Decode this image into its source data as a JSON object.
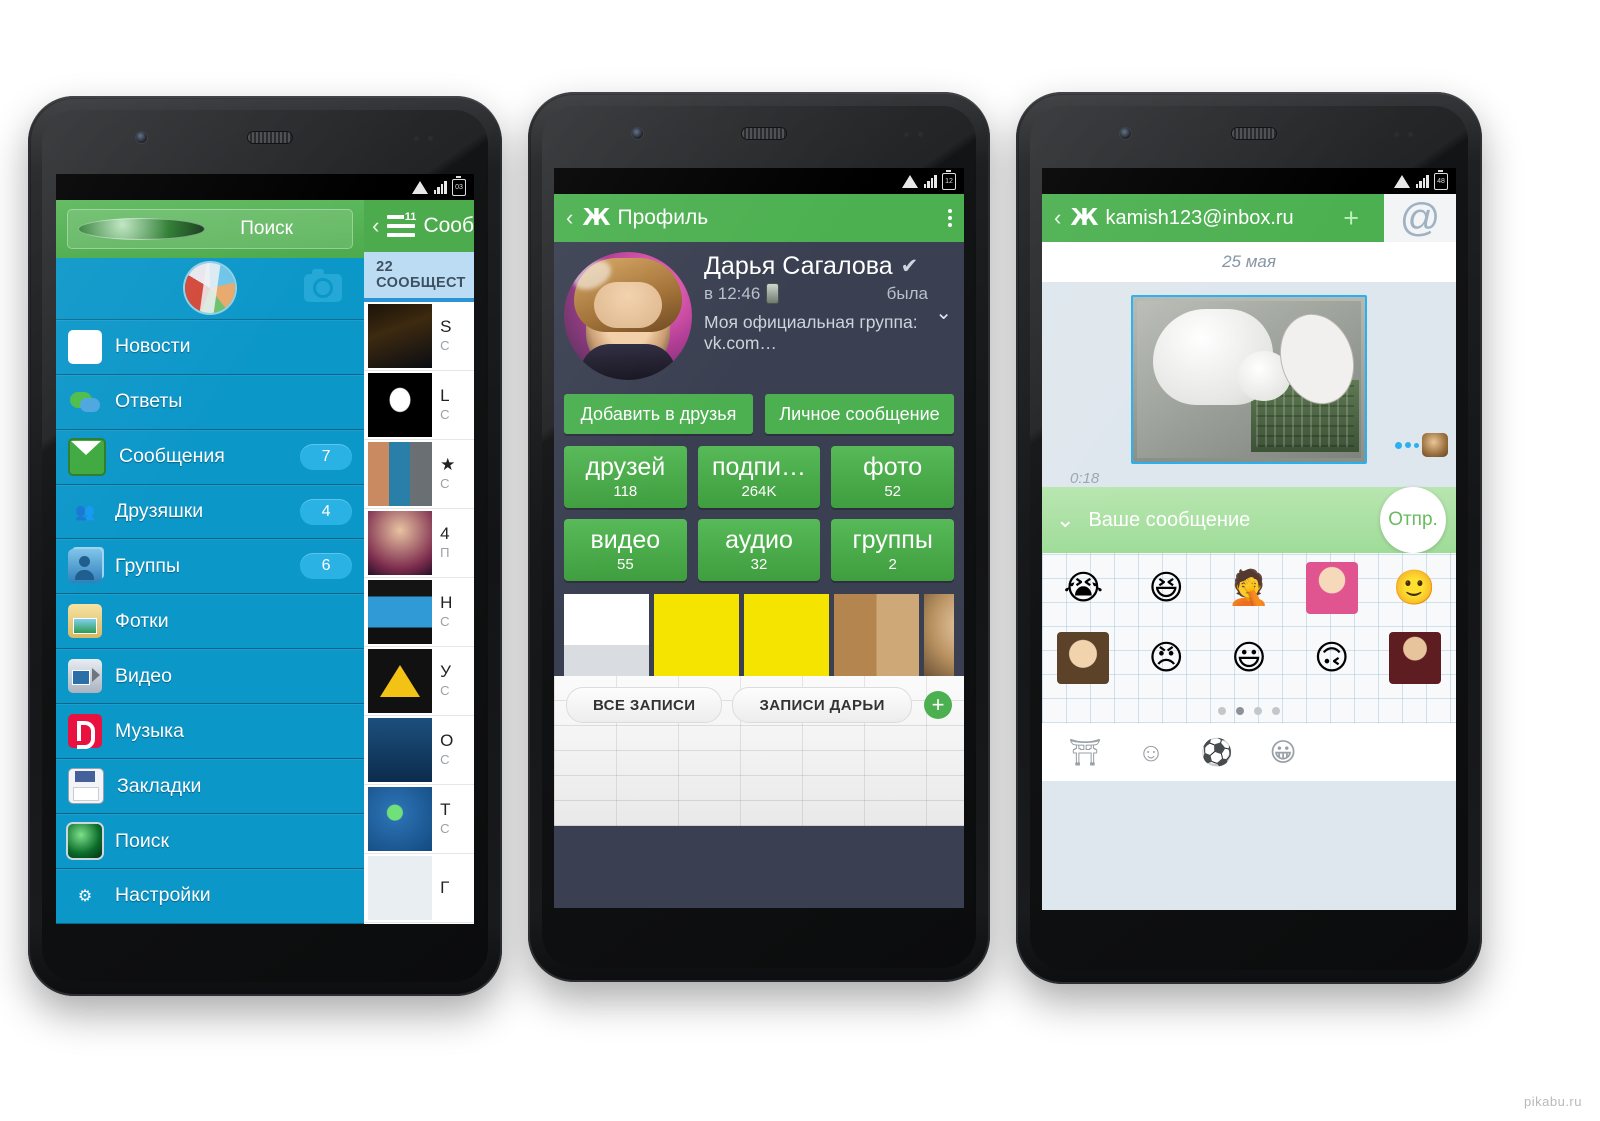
{
  "watermark": "pikabu.ru",
  "phone1": {
    "statusbar": {
      "battery": "03"
    },
    "search": {
      "placeholder": "Поиск",
      "icon": "globe-icon"
    },
    "avatar_row": {
      "avatar": "user-avatar",
      "camera": "camera-icon"
    },
    "menu": [
      {
        "label": "Новости",
        "icon": "cnn-news-icon",
        "badge": ""
      },
      {
        "label": "Ответы",
        "icon": "comments-icon",
        "badge": ""
      },
      {
        "label": "Сообщения",
        "icon": "envelope-icon",
        "badge": "7"
      },
      {
        "label": "Друзяшки",
        "icon": "friends-icon",
        "badge": "4"
      },
      {
        "label": "Группы",
        "icon": "groups-icon",
        "badge": "6"
      },
      {
        "label": "Фотки",
        "icon": "photo-folder-icon",
        "badge": ""
      },
      {
        "label": "Видео",
        "icon": "camcorder-icon",
        "badge": ""
      },
      {
        "label": "Музыка",
        "icon": "beats-music-icon",
        "badge": ""
      },
      {
        "label": "Закладки",
        "icon": "floppy-disk-icon",
        "badge": ""
      },
      {
        "label": "Поиск",
        "icon": "radar-icon",
        "badge": ""
      },
      {
        "label": "Настройки",
        "icon": "gear-icon",
        "badge": ""
      }
    ],
    "peek": {
      "back": "‹",
      "menu_badge": "11",
      "title": "Сооб",
      "subheader": "22 СООБЩЕСТ",
      "rows": [
        {
          "title": "S",
          "sub": "С"
        },
        {
          "title": "L",
          "sub": "С"
        },
        {
          "title": "★",
          "sub": "С"
        },
        {
          "title": "4",
          "sub": "П"
        },
        {
          "title": "Н",
          "sub": "С"
        },
        {
          "title": "У",
          "sub": "С"
        },
        {
          "title": "О",
          "sub": "С"
        },
        {
          "title": "Т",
          "sub": "С"
        },
        {
          "title": "Г",
          "sub": ""
        }
      ]
    }
  },
  "phone2": {
    "statusbar": {
      "battery": "12"
    },
    "appbar": {
      "back": "‹",
      "logo": "vk-logo",
      "title": "Профиль",
      "overflow": "kebab-menu-icon"
    },
    "profile": {
      "name": "Дарья Сагалова",
      "verified": "✔",
      "last_seen_left": "в 12:46",
      "last_seen_right": "была",
      "description": "Моя официальная группа: vk.com…",
      "expand": "⌄"
    },
    "actions": [
      {
        "label": "Добавить в друзья"
      },
      {
        "label": "Личное сообщение"
      }
    ],
    "stats": [
      {
        "key": "друзей",
        "value": "118"
      },
      {
        "key": "подпи…",
        "value": "264K"
      },
      {
        "key": "фото",
        "value": "52"
      },
      {
        "key": "видео",
        "value": "55"
      },
      {
        "key": "аудио",
        "value": "32"
      },
      {
        "key": "группы",
        "value": "2"
      }
    ],
    "photos": [
      {
        "alt": "russian-charity-poster"
      },
      {
        "alt": "yellow-discount-flyer-1"
      },
      {
        "alt": "yellow-discount-flyer-2"
      },
      {
        "alt": "dance-class-collage"
      },
      {
        "alt": "blonde-woman-photo"
      }
    ],
    "wall": {
      "tabs": [
        {
          "label": "ВСЕ ЗАПИСИ"
        },
        {
          "label": "ЗАПИСИ ДАРЬИ"
        }
      ],
      "add": "+"
    }
  },
  "phone3": {
    "statusbar": {
      "battery": "48"
    },
    "appbar": {
      "back": "‹",
      "logo": "vk-logo",
      "title": "kamish123@inbox.ru",
      "add": "+",
      "mail": "@"
    },
    "chat": {
      "date": "25 мая",
      "message_time": "0:18",
      "photo_alt": "cat-inside-computer-case-meme"
    },
    "composer": {
      "collapse": "⌄",
      "placeholder": "Ваше сообщение",
      "send": "Отпр."
    },
    "stickers": {
      "items": [
        {
          "name": "crying-rage-face"
        },
        {
          "name": "yao-ming-face"
        },
        {
          "name": "facepalm-face"
        },
        {
          "name": "girl-what-photo"
        },
        {
          "name": "not-bad-obama-face"
        },
        {
          "name": "surprised-boy-photo"
        },
        {
          "name": "angry-rage-face"
        },
        {
          "name": "me-gusta-face"
        },
        {
          "name": "challenge-accepted-face"
        },
        {
          "name": "man-in-red-photo"
        }
      ],
      "page_dots": 4,
      "active_dot": 2,
      "tools": [
        {
          "name": "sticker-store-icon",
          "glyph": "⛩"
        },
        {
          "name": "emoji-icon",
          "glyph": "☺"
        },
        {
          "name": "fireball-icon",
          "glyph": "⚽"
        },
        {
          "name": "troll-face-icon",
          "glyph": "😀"
        }
      ]
    }
  }
}
